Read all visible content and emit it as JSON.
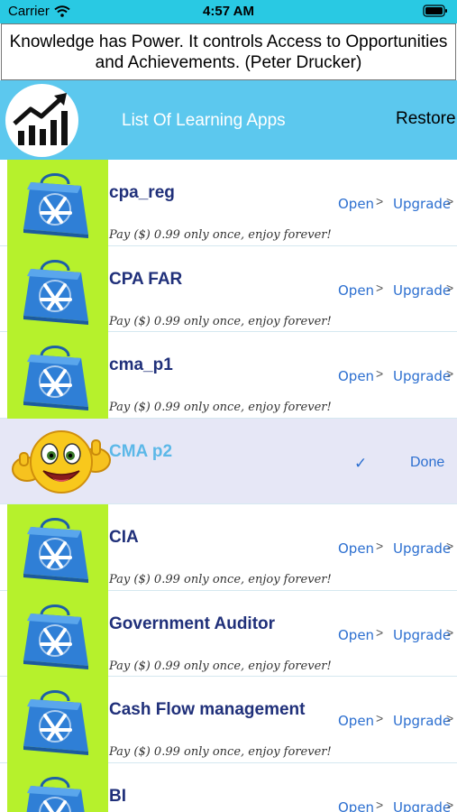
{
  "status_bar": {
    "carrier": "Carrier",
    "time": "4:57 AM"
  },
  "quote": "Knowledge has Power. It controls Access to Opportunities and Achievements. (Peter Drucker)",
  "nav": {
    "title": "List Of Learning Apps",
    "restore_label": "Restore"
  },
  "colors": {
    "status_bar": "#29c9e3",
    "nav_bar": "#5cc8ee",
    "thumb_bg": "#b6f12c",
    "link": "#2c6fd0",
    "app_name": "#20307a"
  },
  "apps": [
    {
      "name": "cpa_reg",
      "price_text": "Pay ($)  0.99 only once, enjoy forever!",
      "open_label": "Open",
      "upgrade_label": "Upgrade",
      "chevron": ">"
    },
    {
      "name": "CPA FAR",
      "price_text": "Pay ($)  0.99 only once, enjoy forever!",
      "open_label": "Open",
      "upgrade_label": "Upgrade",
      "chevron": ">"
    },
    {
      "name": "cma_p1",
      "price_text": "Pay ($)  0.99 only once, enjoy forever!",
      "open_label": "Open",
      "upgrade_label": "Upgrade",
      "chevron": ">"
    },
    {
      "name": "CMA p2",
      "check": "✓",
      "done_label": "Done"
    },
    {
      "name": "CIA",
      "price_text": "Pay ($)  0.99 only once, enjoy forever!",
      "open_label": "Open",
      "upgrade_label": "Upgrade",
      "chevron": ">"
    },
    {
      "name": "Government Auditor",
      "price_text": "Pay ($)  0.99 only once, enjoy forever!",
      "open_label": "Open",
      "upgrade_label": "Upgrade",
      "chevron": ">"
    },
    {
      "name": "Cash Flow management",
      "price_text": "Pay ($)  0.99 only once, enjoy forever!",
      "open_label": "Open",
      "upgrade_label": "Upgrade",
      "chevron": ">"
    },
    {
      "name": "BI",
      "open_label": "Open",
      "upgrade_label": "Upgrade",
      "chevron": ">"
    }
  ]
}
